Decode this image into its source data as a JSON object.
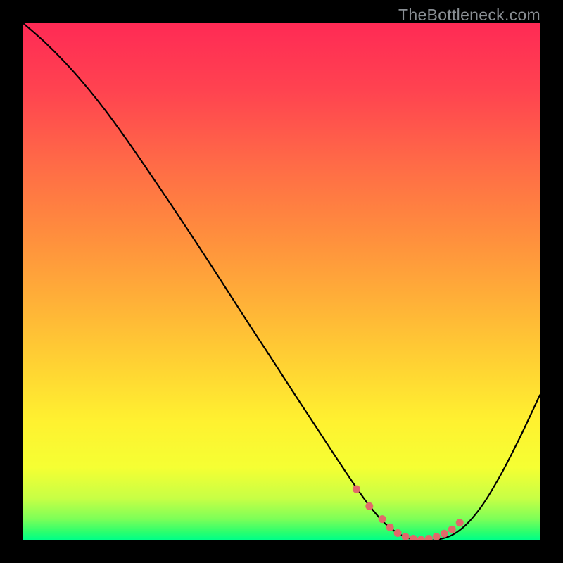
{
  "watermark": "TheBottleneck.com",
  "chart_data": {
    "type": "line",
    "title": "",
    "xlabel": "",
    "ylabel": "",
    "xlim": [
      0,
      100
    ],
    "ylim": [
      0,
      100
    ],
    "grid": false,
    "series": [
      {
        "name": "bottleneck-curve",
        "x": [
          0,
          4,
          8,
          12,
          16,
          20,
          24,
          28,
          32,
          36,
          40,
          44,
          48,
          52,
          56,
          60,
          64,
          67,
          70,
          73,
          76,
          80,
          84,
          88,
          92,
          96,
          100
        ],
        "y": [
          100,
          96.5,
          92.5,
          88,
          83,
          77.5,
          71.7,
          65.8,
          59.8,
          53.7,
          47.5,
          41.3,
          35.2,
          29.0,
          22.9,
          16.8,
          10.8,
          6.6,
          3.2,
          1.0,
          0.0,
          0.0,
          1.5,
          5.5,
          11.8,
          19.5,
          28.0
        ]
      }
    ],
    "markers": {
      "name": "highlight-points",
      "x": [
        64.5,
        67.0,
        69.5,
        71.0,
        72.5,
        74.0,
        75.5,
        77.0,
        78.5,
        80.0,
        81.5,
        83.0,
        84.5
      ],
      "y": [
        9.8,
        6.5,
        4.0,
        2.4,
        1.3,
        0.6,
        0.2,
        0.0,
        0.2,
        0.6,
        1.2,
        2.0,
        3.3
      ],
      "color": "#e16a6a"
    },
    "gradient_stops": [
      {
        "offset": 0.0,
        "color": "#ff2a55"
      },
      {
        "offset": 0.13,
        "color": "#ff4350"
      },
      {
        "offset": 0.27,
        "color": "#ff6a47"
      },
      {
        "offset": 0.4,
        "color": "#ff8b3e"
      },
      {
        "offset": 0.53,
        "color": "#ffae38"
      },
      {
        "offset": 0.66,
        "color": "#ffd233"
      },
      {
        "offset": 0.77,
        "color": "#fff130"
      },
      {
        "offset": 0.86,
        "color": "#f5ff33"
      },
      {
        "offset": 0.92,
        "color": "#c7ff45"
      },
      {
        "offset": 0.96,
        "color": "#7cff58"
      },
      {
        "offset": 0.985,
        "color": "#2bff6e"
      },
      {
        "offset": 1.0,
        "color": "#00ff88"
      }
    ]
  }
}
